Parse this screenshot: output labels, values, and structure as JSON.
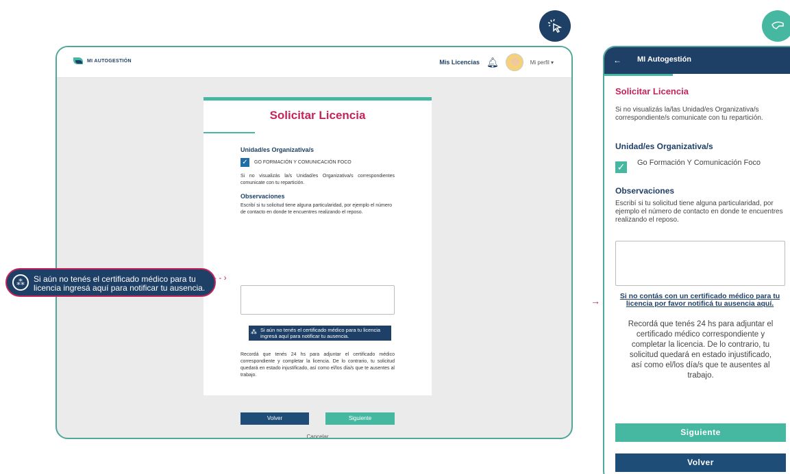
{
  "badges": {
    "desktop_icon": "cursor-click-icon",
    "mobile_icon": "hand-touch-icon"
  },
  "desktop": {
    "logo_text": "MI AUTOGESTIÓN",
    "nav_link": "Mis Licencias",
    "profile_label": "Mi perfil",
    "card": {
      "title": "Solicitar Licencia",
      "unidad_heading": "Unidad/es Organizativa/s",
      "unidad_checkbox_label": "GO FORMACIÓN Y COMUNICACIÓN FOCO",
      "unidad_note": "Si no visualizás la/s Unidad/es Organizativa/s correspondientes comunicate con tu repartición.",
      "observaciones_heading": "Observaciones",
      "observaciones_help": "Escribí si tu solicitud tiene alguna particularidad, por ejemplo el número de contacto en donde te encuentres realizando el reposo.",
      "banner_text": "Si aún no tenés el certificado médico para tu licencia ingresá aquí para notificar tu ausencia.",
      "recuerda_text": "Recordá que tenés 24 hs para adjuntar el certificado médico correspondiente y completar la licencia. De lo contrario, tu solicitud quedará en estado injustificado, así como el/los día/s que te ausentes al trabajo.",
      "volver": "Volver",
      "siguiente": "Siguiente",
      "cancelar": "Cancelar"
    },
    "callout_text": "Si aún no tenés el certificado médico para tu licencia ingresá aquí para notificar tu ausencia."
  },
  "mobile": {
    "header_title": "MI Autogestión",
    "title": "Solicitar Licencia",
    "unidad_note": "Si no visualizás la/las Unidad/es Organizativa/s correspondiente/s comunicate con tu repartición.",
    "unidad_heading": "Unidad/es Organizativa/s",
    "unidad_checkbox_label": "Go Formación Y Comunicación Foco",
    "observaciones_heading": "Observaciones",
    "observaciones_help": "Escribí si tu solicitud tiene alguna particularidad, por ejemplo el número de contacto en donde te encuentres realizando el reposo.",
    "link_text": "Si no contás con un certificado médico para tu licencia por favor notificá tu ausencia aquí.",
    "recuerda_text": "Recordá que tenés 24 hs para adjuntar el certificado médico correspondiente y completar la licencia. De lo contrario, tu solicitud quedará en estado injustificado, así como el/los día/s que te ausentes al trabajo.",
    "siguiente": "Siguiente",
    "volver": "Volver"
  },
  "colors": {
    "navy": "#1e3f66",
    "teal": "#46b8a2",
    "magenta": "#c4245a"
  }
}
